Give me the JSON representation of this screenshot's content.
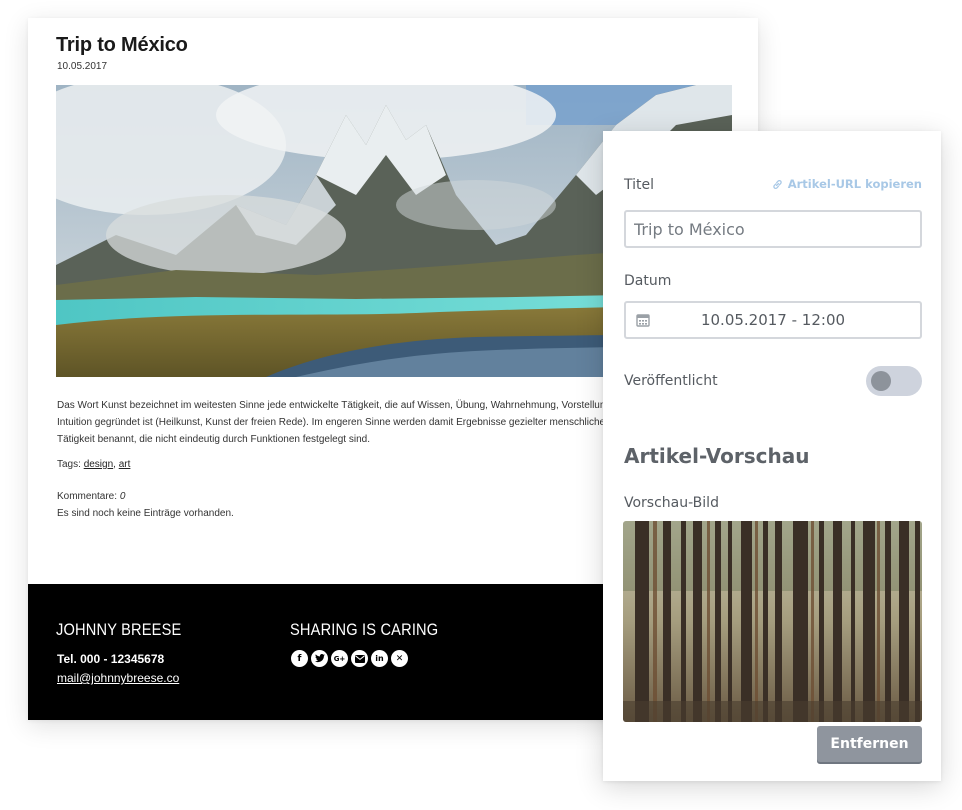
{
  "post": {
    "title": "Trip to México",
    "date": "10.05.2017",
    "body": "Das Wort Kunst bezeichnet im weitesten Sinne jede entwickelte Tätigkeit, die auf Wissen, Übung, Wahrnehmung, Vorstellung und Intuition gegründet ist (Heilkunst, Kunst der freien Rede). Im engeren Sinne werden damit Ergebnisse gezielter menschlicher Tätigkeit benannt, die nicht eindeutig durch Funktionen festgelegt sind.",
    "tags_label": "Tags:",
    "tags": [
      "design",
      "art"
    ],
    "tags_sep": ",",
    "comments_label": "Kommentare:",
    "comments_count": "0",
    "no_entries": "Es sind noch keine Einträge vorhanden."
  },
  "footer": {
    "name": "JOHNNY BREESE",
    "tel": "Tel. 000 - 12345678",
    "mail": "mail@johnnybreese.co",
    "share_title": "SHARING IS CARING",
    "social_icons": [
      "facebook-icon",
      "twitter-icon",
      "google-plus-icon",
      "email-icon",
      "linkedin-icon",
      "xing-icon"
    ]
  },
  "panel": {
    "title_label": "Titel",
    "copy_url_label": "Artikel-URL kopieren",
    "title_value": "Trip to México",
    "date_label": "Datum",
    "date_value": "10.05.2017 - 12:00",
    "published_label": "Veröffentlicht",
    "published": false,
    "preview_heading": "Artikel-Vorschau",
    "preview_image_label": "Vorschau-Bild",
    "remove_label": "Entfernen"
  },
  "colors": {
    "link_blue": "#a8c8e6",
    "button_gray": "#8f959e",
    "toggle_track": "#ced3dd",
    "footer_bg": "#000000"
  }
}
